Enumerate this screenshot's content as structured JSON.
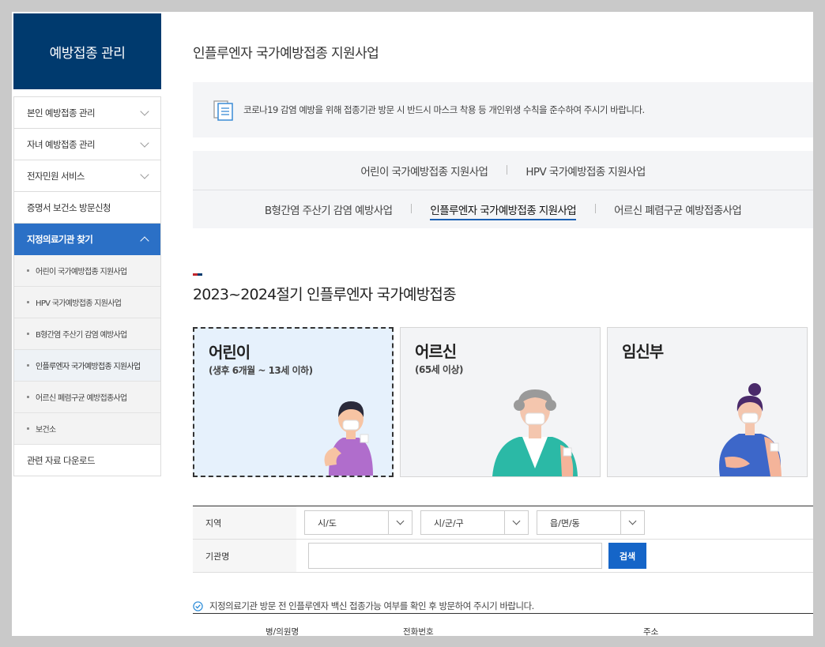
{
  "sidebar": {
    "title": "예방접종 관리",
    "items": [
      {
        "label": "본인 예방접종 관리"
      },
      {
        "label": "자녀 예방접종 관리"
      },
      {
        "label": "전자민원 서비스"
      },
      {
        "label": "증명서 보건소 방문신청"
      },
      {
        "label": "지정의료기관 찾기"
      }
    ],
    "sub_items": [
      {
        "label": "어린이 국가예방접종 지원사업"
      },
      {
        "label": "HPV 국가예방접종 지원사업"
      },
      {
        "label": "B형간염 주산기 감염 예방사업"
      },
      {
        "label": "인플루엔자 국가예방접종 지원사업"
      },
      {
        "label": "어르신 폐렴구균 예방접종사업"
      },
      {
        "label": "보건소"
      }
    ],
    "download": "관련 자료 다운로드"
  },
  "main": {
    "title": "인플루엔자 국가예방접종 지원사업",
    "notice": "코로나19 감염 예방을 위해 접종기관 방문 시 반드시 마스크 착용 등 개인위생 수칙을 준수하여 주시기 바랍니다.",
    "tabs_row1": [
      "어린이 국가예방접종 지원사업",
      "HPV 국가예방접종 지원사업"
    ],
    "tabs_row2": [
      "B형간염 주산기 감염 예방사업",
      "인플루엔자 국가예방접종 지원사업",
      "어르신 폐렴구균 예방접종사업"
    ],
    "section_title": "2023~2024절기 인플루엔자 국가예방접종",
    "cards": [
      {
        "name": "어린이",
        "sub": "(생후 6개월 ~ 13세 이하)"
      },
      {
        "name": "어르신",
        "sub": "(65세 이상)"
      },
      {
        "name": "임신부",
        "sub": ""
      }
    ],
    "search": {
      "region_label": "지역",
      "sido": "시/도",
      "sigungu": "시/군/구",
      "eupmyeondong": "읍/면/동",
      "org_label": "기관명",
      "button": "검색"
    },
    "info": "지정의료기관 방문 전 인플루엔자 백신 접종가능 여부를 확인 후 방문하여 주시기 바랍니다.",
    "table_headers": [
      "병/의원명",
      "전화번호",
      "주소"
    ]
  },
  "colors": {
    "sidebar_head": "#003a6e",
    "active_menu": "#2b70c6",
    "search_button": "#1565c8"
  }
}
